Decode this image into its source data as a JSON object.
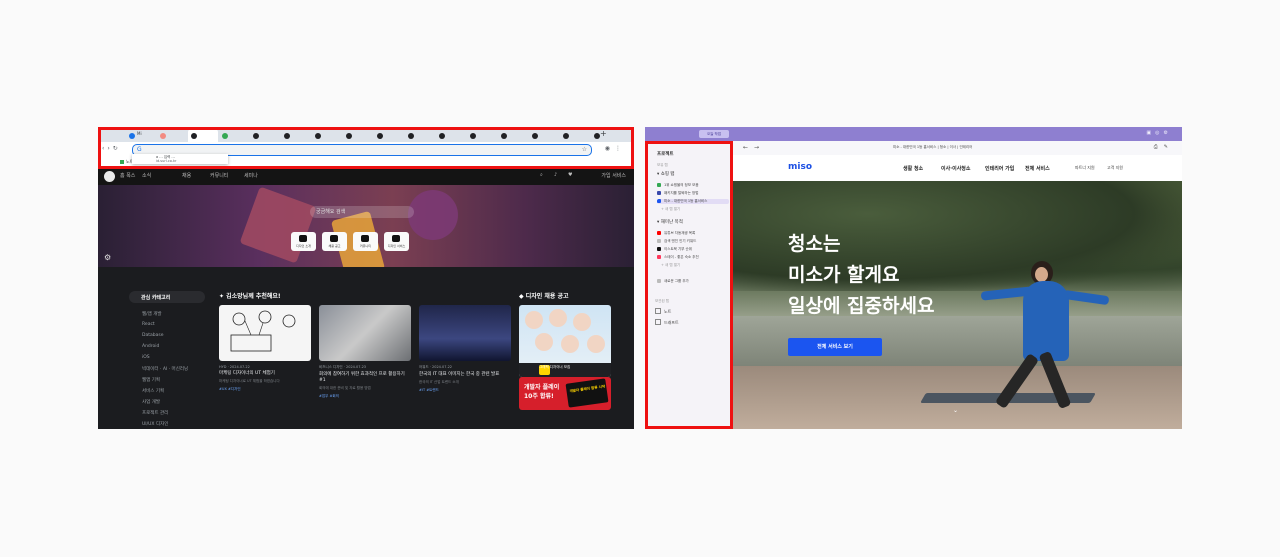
{
  "left": {
    "tabs": [
      "Mi",
      "",
      "",
      "",
      "",
      "",
      "",
      "",
      "",
      "",
      "",
      "",
      "",
      "",
      "",
      "",
      ""
    ],
    "tab_labels": [
      "Mi",
      "",
      "",
      "",
      "",
      "",
      "",
      "",
      "",
      "",
      "",
      "",
      "",
      "",
      "",
      "",
      ""
    ],
    "omnibox_value": "",
    "suggestion": [
      "a … 입력 …",
      "id.surl.co.kr"
    ],
    "bookmarks": [
      "노트",
      "사운드"
    ],
    "site_nav": {
      "items": [
        "홈 폭스",
        "소식",
        "채용",
        "커뮤니티",
        "세미나"
      ],
      "right": "가입 서비스"
    },
    "hero": {
      "search_placeholder": "궁금해요 검색",
      "quick": [
        "디자인 소개",
        "채용 공고",
        "커뮤니티",
        "디자인 서비스"
      ]
    },
    "sidebar": {
      "title": "관심 카테고리",
      "categories": [
        "웹/앱 개발",
        "React",
        "Database",
        "Android",
        "iOS",
        "빅데이터 · AI · 머신러닝",
        "웹앱 기획",
        "서비스 기획",
        "사업 개발",
        "프로젝트 관리",
        "UI/UX 디자인"
      ]
    },
    "recommend_title": "김소망님께 추천해요!",
    "cards": [
      {
        "meta": "HYD · 2024.07.22",
        "title": "마케팅 디자이너의 UT 체험기",
        "sub": "마케팅 디자이너로 UT 체험을 하였습니다",
        "tag": "#UX #디자인"
      },
      {
        "meta": "비즈니스 디자인 · 2024.07.23",
        "title": "회의에 참여하기 위한 효과적인 프로 활용하기 #1",
        "sub": "회의에 대한 준비 및 자료 활용 방법",
        "tag": "#업무 #회의"
      },
      {
        "meta": "어워드 · 2024.07.22",
        "title": "한국의 IT 대표 이미지는 한국 중 관련 발표",
        "sub": "한국의 IT 산업 트렌드 소개",
        "tag": "#IT #트렌드"
      }
    ],
    "jobs_title": "디자인 채용 공고",
    "ad_text": "그래픽 디자이너 모집",
    "promo": {
      "line1": "개발자 플레이",
      "line2": "10주 합류!",
      "book": "개발자 플레이 합류 시작"
    }
  },
  "right": {
    "pill": "오늘 작업",
    "vtabs": {
      "header": "프로젝트",
      "sub": "보유 탭",
      "groups": [
        "쇼핑 탭",
        "재미난 목적"
      ],
      "items1": [
        "1위 쇼핑몰의 정보 모음",
        "패키지를 탈퇴하는 방법",
        "미소 - 대한민국 1등 홈서비스"
      ],
      "items2": [
        "유튜브 자동재생 목록",
        "검색 엔진 인기 키워드",
        "이스트북 기부 순위",
        "스테이 - 좋은 숙소 추천"
      ],
      "more": [
        "+ 새 탭 열기",
        "+ 새 탭 열기"
      ],
      "new_group": "새로운 그룹 추가",
      "section": "보관된 탭",
      "checks": [
        "노트",
        "드래프트"
      ]
    },
    "url": "미소 - 대한민국 1등 홈서비스 | 청소 | 이사 | 인테리어",
    "brand": "miso",
    "nav": [
      "생활 청소",
      "이사·이사청소",
      "인테리어 가입",
      "전체 서비스"
    ],
    "nav_sub": [
      "파트너 지원",
      "고객 지원"
    ],
    "headline": [
      "청소는",
      "미소가 할게요",
      "일상에 집중하세요"
    ],
    "cta": "전체 서비스 보기"
  },
  "colors": {
    "highlight": "#ee1111",
    "miso_blue": "#1b55f0"
  }
}
